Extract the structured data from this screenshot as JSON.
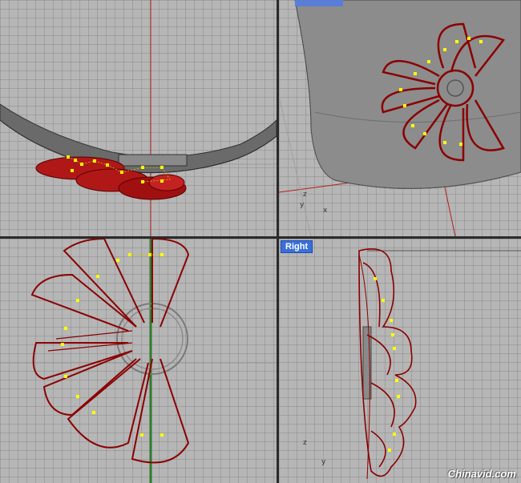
{
  "viewports": {
    "top": {
      "label": ""
    },
    "perspective": {
      "label": ""
    },
    "front": {
      "label": ""
    },
    "right": {
      "label": "Right"
    }
  },
  "axes": {
    "perspective": {
      "z": "z",
      "y": "y",
      "x": "x"
    },
    "right": {
      "z": "z",
      "y": "y"
    }
  },
  "colors": {
    "wire": "#8b0000",
    "surface": "#b01818",
    "control_point": "#ffff00",
    "axis_red": "#b02020",
    "axis_green": "#2f7a2f",
    "label_bg": "#3a6fd8"
  },
  "watermark": "Chinavid.com"
}
